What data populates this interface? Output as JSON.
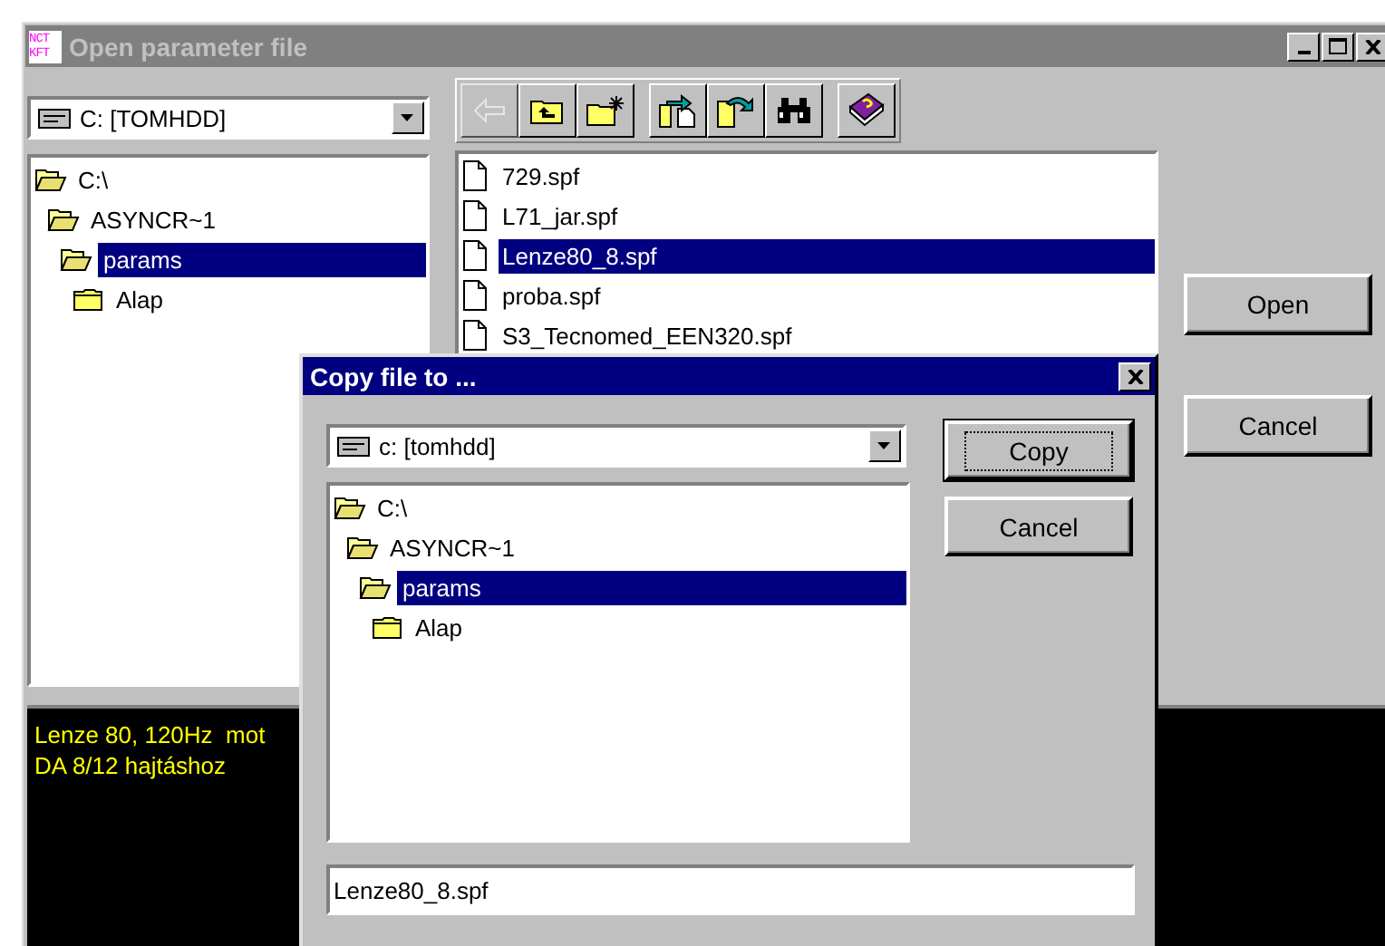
{
  "window": {
    "title": "Open parameter file",
    "app_icon_text": [
      "NCT",
      "KFT"
    ],
    "active": false
  },
  "drive": {
    "value": "C: [TOMHDD]"
  },
  "toolbar": [
    {
      "kind": "back",
      "disabled": true
    },
    {
      "kind": "up",
      "disabled": false
    },
    {
      "kind": "new_folder",
      "disabled": false
    },
    {
      "kind": "copy",
      "disabled": false
    },
    {
      "kind": "move",
      "disabled": false
    },
    {
      "kind": "find",
      "disabled": false
    },
    {
      "kind": "help",
      "disabled": false
    }
  ],
  "folder_tree": [
    {
      "label": "C:\\",
      "expanded": true,
      "selected": false,
      "children": [
        {
          "label": "ASYNCR~1",
          "expanded": true,
          "selected": false,
          "children": [
            {
              "label": "params",
              "expanded": true,
              "selected": true,
              "children": [
                {
                  "label": "Alap",
                  "expanded": false,
                  "selected": false
                }
              ]
            }
          ]
        }
      ]
    }
  ],
  "files": [
    {
      "name": "729.spf",
      "selected": false
    },
    {
      "name": "L71_jar.spf",
      "selected": false
    },
    {
      "name": "Lenze80_8.spf",
      "selected": true
    },
    {
      "name": "proba.spf",
      "selected": false
    },
    {
      "name": "S3_Tecnomed_EEN320.spf",
      "selected": false
    }
  ],
  "buttons": [
    "Open",
    "Cancel"
  ],
  "description": [
    "Lenze 80, 120Hz  mot",
    "DA 8/12 hajtáshoz"
  ],
  "dialog": {
    "title": "Copy file to ...",
    "active": true,
    "drive": {
      "value": "c: [tomhdd]"
    },
    "folder_tree": [
      {
        "label": "C:\\",
        "expanded": true,
        "selected": false,
        "children": [
          {
            "label": "ASYNCR~1",
            "expanded": true,
            "selected": false,
            "children": [
              {
                "label": "params",
                "expanded": true,
                "selected": true,
                "children": [
                  {
                    "label": "Alap",
                    "expanded": false,
                    "selected": false
                  }
                ]
              }
            ]
          }
        ]
      }
    ],
    "buttons": [
      {
        "label": "Copy",
        "default": true
      },
      {
        "label": "Cancel",
        "default": false
      }
    ],
    "filename": {
      "value": "Lenze80_8.spf"
    }
  }
}
